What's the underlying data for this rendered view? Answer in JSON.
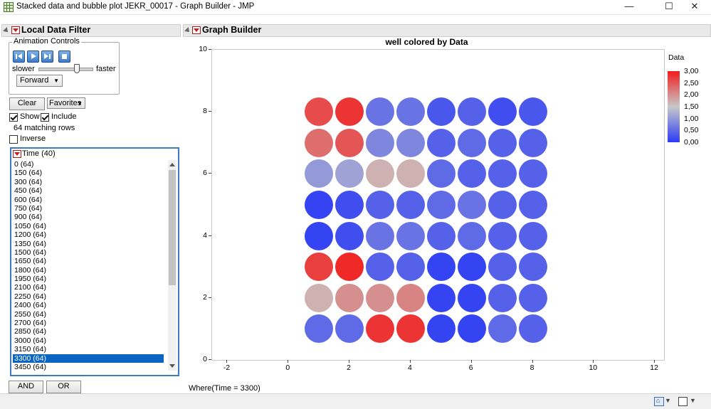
{
  "window": {
    "title": "Stacked data and bubble plot JEKR_00017 - Graph Builder - JMP",
    "minimize": "—",
    "maximize": "☐",
    "close": "✕"
  },
  "filter": {
    "header": "Local Data Filter",
    "animation": {
      "label": "Animation Controls",
      "slower": "slower",
      "faster": "faster",
      "direction": "Forward",
      "speed": 0.75
    },
    "clear": "Clear",
    "favorites": "Favorites",
    "show": "Show",
    "include": "Include",
    "matching": "64 matching rows",
    "inverse": "Inverse",
    "list_header": "Time (40)",
    "items": [
      "0 (64)",
      "150 (64)",
      "300 (64)",
      "450 (64)",
      "600 (64)",
      "750 (64)",
      "900 (64)",
      "1050 (64)",
      "1200 (64)",
      "1350 (64)",
      "1500 (64)",
      "1650 (64)",
      "1800 (64)",
      "1950 (64)",
      "2100 (64)",
      "2250 (64)",
      "2400 (64)",
      "2550 (64)",
      "2700 (64)",
      "2850 (64)",
      "3000 (64)",
      "3150 (64)",
      "3300 (64)",
      "3450 (64)"
    ],
    "selected_index": 22,
    "and": "AND",
    "or": "OR"
  },
  "graph": {
    "header": "Graph Builder",
    "where": "Where(Time = 3300)"
  },
  "chart_data": {
    "type": "scatter",
    "title": "well colored by Data",
    "xlabel": "",
    "ylabel": "",
    "xlim": [
      -2.5,
      12.3
    ],
    "ylim": [
      0,
      10
    ],
    "xticks": [
      -2,
      0,
      2,
      4,
      6,
      8,
      10,
      12
    ],
    "yticks": [
      0,
      2,
      4,
      6,
      8,
      10
    ],
    "x": [
      1,
      2,
      3,
      4,
      5,
      6,
      7,
      8
    ],
    "y": [
      8,
      7,
      6,
      5,
      4,
      3,
      2,
      1
    ],
    "values": [
      [
        2.6,
        2.8,
        0.6,
        0.6,
        0.3,
        0.4,
        0.2,
        0.3
      ],
      [
        2.3,
        2.5,
        0.8,
        0.8,
        0.4,
        0.5,
        0.4,
        0.4
      ],
      [
        1.0,
        1.1,
        1.7,
        1.7,
        0.5,
        0.4,
        0.4,
        0.4
      ],
      [
        0.1,
        0.2,
        0.4,
        0.4,
        0.5,
        0.6,
        0.4,
        0.4
      ],
      [
        0.1,
        0.2,
        0.6,
        0.6,
        0.4,
        0.5,
        0.4,
        0.4
      ],
      [
        2.7,
        2.9,
        0.4,
        0.4,
        0.1,
        0.1,
        0.4,
        0.4
      ],
      [
        1.7,
        2.0,
        2.0,
        2.1,
        0.1,
        0.1,
        0.4,
        0.4
      ],
      [
        0.5,
        0.5,
        2.8,
        2.8,
        0.1,
        0.1,
        0.5,
        0.4
      ]
    ],
    "legend": {
      "title": "Data",
      "position": "right",
      "labels": [
        "3,00",
        "2,50",
        "2,00",
        "1,50",
        "1,00",
        "0,50",
        "0,00"
      ],
      "min": 0,
      "max": 3
    },
    "colors": {
      "low": "#2b3bf5",
      "mid": "#c8c8c8",
      "high": "#f21d1d"
    }
  }
}
